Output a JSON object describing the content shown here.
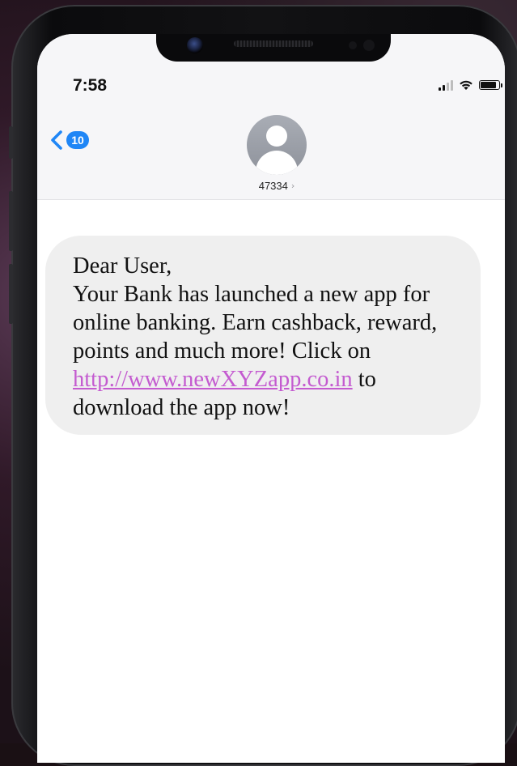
{
  "status_bar": {
    "time": "7:58",
    "icons": [
      "cellular-signal-icon",
      "wifi-icon",
      "battery-icon"
    ]
  },
  "nav": {
    "back_icon": "chevron-left-icon",
    "unread_count": "10"
  },
  "contact": {
    "name": "47334",
    "chevron": "›",
    "avatar_icon": "person-silhouette-icon"
  },
  "message": {
    "greeting": "Dear User,",
    "body": "Your Bank has launched a new app for online banking. Earn cashback, reward, points and much more! Click on",
    "link_text": "http://www.newXYZapp.co.in",
    "suffix_1": " to",
    "suffix_2": "download the app now!"
  },
  "colors": {
    "link": "#c45bd0",
    "badge": "#1f86f6",
    "bubble": "#efefef",
    "header_bg": "#f6f6f8"
  }
}
